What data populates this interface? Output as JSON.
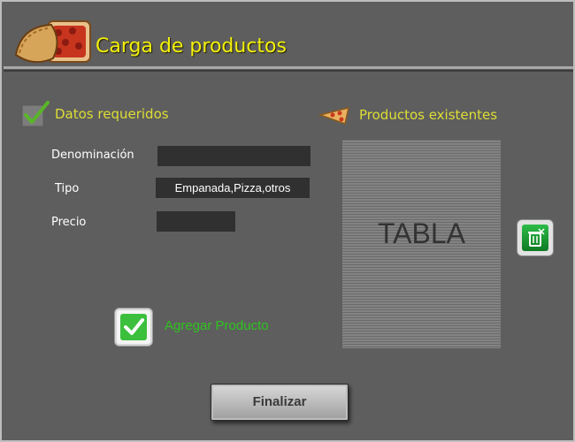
{
  "header": {
    "title": "Carga de productos",
    "icon": "empanada-pizza-icon"
  },
  "required_section": {
    "title": "Datos requeridos",
    "icon": "checkmark-icon"
  },
  "form": {
    "denominacion_label": "Denominación",
    "denominacion_value": "",
    "tipo_label": "Tipo",
    "tipo_value": "Empanada,Pizza,otros",
    "precio_label": "Precio",
    "precio_value": ""
  },
  "add_product": {
    "label": "Agregar Producto",
    "icon": "check-icon"
  },
  "existing_section": {
    "title": "Productos existentes",
    "icon": "pizza-icon",
    "table_placeholder": "TABLA"
  },
  "delete": {
    "icon": "trash-icon"
  },
  "finalize": {
    "label": "Finalizar"
  },
  "colors": {
    "title": "#f3f00a",
    "section_title": "#dede36",
    "add_label": "#2fc41f",
    "background": "#5e5e5e"
  }
}
